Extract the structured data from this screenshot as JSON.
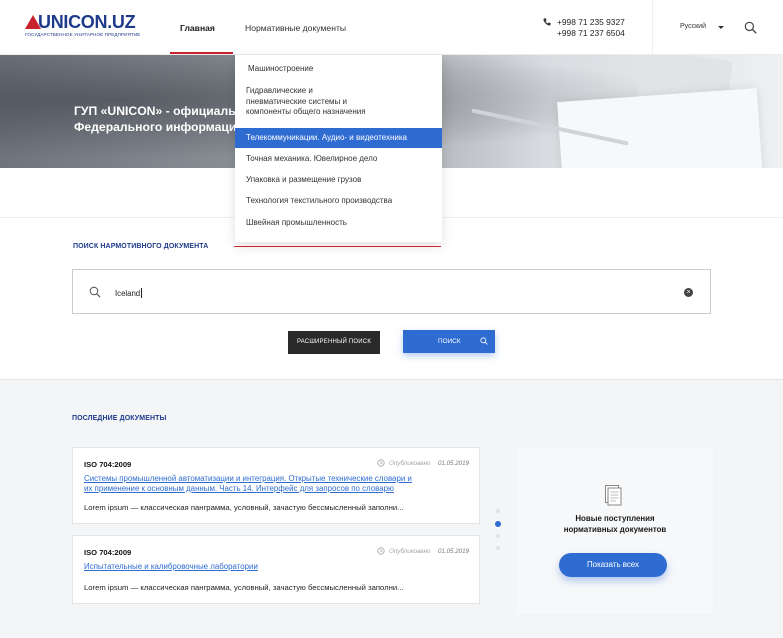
{
  "header": {
    "logo_text": "UNICON.UZ",
    "logo_subtitle": "ГОСУДАРСТВЕННОЕ УНИТАРНОЕ ПРЕДПРИЯТИЕ",
    "nav_main": "Главная",
    "nav_docs": "Нормативные документы",
    "phone_1": "+998 71 235 9327",
    "phone_2": "+998 71 237 6504",
    "language": "Русский",
    "accent_color": "#c8232c",
    "brand_color": "#1e3a8a"
  },
  "dropdown": {
    "items": [
      "Машиностроение",
      "Гидравлические и",
      "пневматические системы и",
      "компоненты общего назначения",
      "Телекоммуникации. Аудио- и видеотехника",
      "Точная механика. Ювелирное дело",
      "Упаковка и размещение грузов",
      "Технология текстильного производства",
      "Швейная промышленность"
    ],
    "active_color": "#2e6cd1"
  },
  "hero": {
    "line1": "ГУП «UNICON» - официаль",
    "line2": "Федерального информаци"
  },
  "search": {
    "heading": "ПОИСК НАРМОТИВНОГО ДОКУМЕНТА",
    "value": "Iceland",
    "advanced_label": "РАСШИРЕННЫЙ ПОИСК",
    "search_label": "ПОИСК"
  },
  "latest": {
    "heading": "ПОСЛЕДНИЕ  ДОКУМЕНТЫ",
    "docs": [
      {
        "code": "ISO 704:2009",
        "published_label": "Опубликовано",
        "date": "01.05.2019",
        "title_line1": "Системы промышленной автоматизации и интеграция. Открытые технические словари и",
        "title_line2": "их применение к основным данным. Часть 14. Интерфейс для запросов по словарю",
        "desc": "Lorem ipsum — классическая панграмма, условный, зачастую бессмысленный заполни..."
      },
      {
        "code": "ISO 704:2009",
        "published_label": "Опубликовано",
        "date": "01.05.2019",
        "title_line1": "Испытательные и калибровочные лаборатории",
        "desc": "Lorem ipsum — классическая панграмма, условный, зачастую бессмысленный заполни..."
      }
    ]
  },
  "new_docs": {
    "title_line1": "Новые поступления",
    "title_line2": "нормативных документов",
    "button_label": "Показать всех"
  }
}
